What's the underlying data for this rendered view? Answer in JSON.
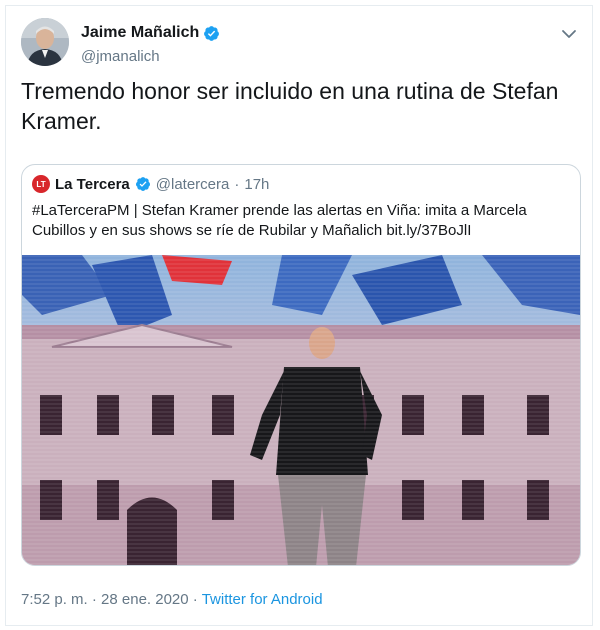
{
  "author": {
    "name": "Jaime Mañalich",
    "handle": "@jmanalich"
  },
  "tweet_text": "Tremendo honor ser incluido en una rutina de Stefan Kramer.",
  "quoted": {
    "logo_text": "LT",
    "name": "La Tercera",
    "handle": "@latercera",
    "separator": "·",
    "time": "17h",
    "text": "#LaTerceraPM | Stefan Kramer prende las alertas en Viña: imita a Marcela Cubillos y en sus shows se ríe de Rubilar y Mañalich bit.ly/37BoJlI"
  },
  "footer": {
    "timestamp": "7:52 p. m. · 28 ene. 2020 · ",
    "client": "Twitter for Android"
  },
  "icons": {
    "verified": "verified-badge-icon",
    "more": "chevron-down-icon"
  },
  "colors": {
    "link": "#1b95e0",
    "verified": "#1da1f2",
    "muted": "#657786",
    "logo": "#d8262b"
  }
}
